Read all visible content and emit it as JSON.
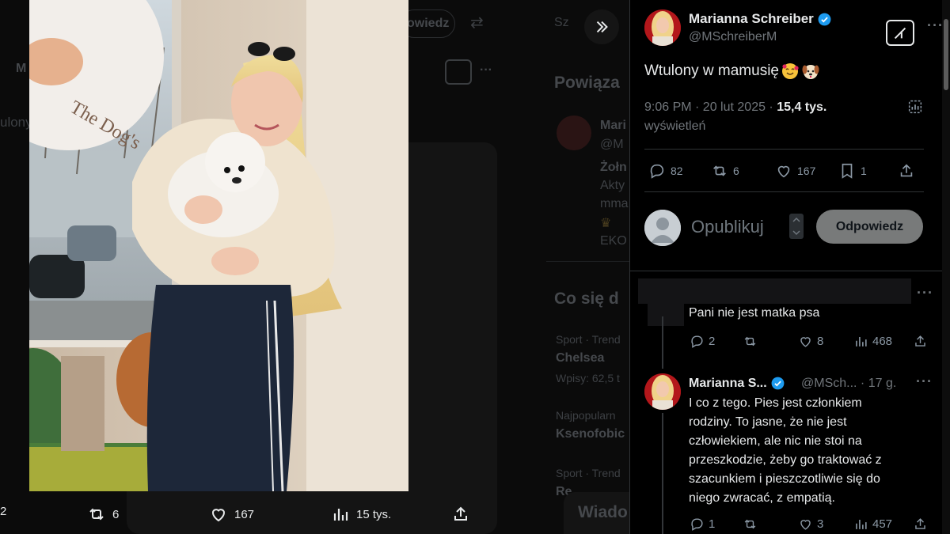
{
  "background": {
    "left_fragment_top": "M",
    "left_fragment_2": "ulony",
    "reply_button_fragment": "owiedz",
    "search_fragment": "Sz",
    "related_heading": "Powiąza",
    "related_author": "Mari",
    "related_handle": "@M",
    "related_line1": "Żołn",
    "related_line2": "Akty",
    "related_line3": "mma",
    "related_line4": "EKO",
    "trending_heading": "Co się d",
    "trend1_category": "Sport · Trend",
    "trend1_name": "Chelsea",
    "trend1_posts": "Wpisy: 62,5 t",
    "trend2_category": "Najpopularn",
    "trend2_name": "Ksenofobic",
    "trend3_category": "Sport · Trend",
    "trend3_name": "Re",
    "messages_fragment": "Wiado",
    "sign_text": "The Dog's"
  },
  "media_bar": {
    "replies_fragment": "2",
    "reposts": "6",
    "likes": "167",
    "views": "15 tys."
  },
  "post": {
    "author_name": "Marianna Schreiber",
    "author_handle": "@MSchreiberM",
    "text": "Wtulony w mamusię",
    "time": "9:06 PM · 20 lut 2025",
    "views_count": "15,4 tys.",
    "views_label": "wyświetleń",
    "replies": "82",
    "reposts": "6",
    "likes": "167",
    "bookmarks": "1"
  },
  "reply_box": {
    "placeholder": "Opublikuj",
    "button": "Odpowiedz"
  },
  "comments": [
    {
      "text": "Pani nie jest matka psa",
      "replies": "2",
      "reposts": "",
      "likes": "8",
      "views": "468"
    },
    {
      "author_name": "Marianna S...",
      "author_handle": "@MSch... · 17 g.",
      "lines": [
        "I co z tego. Pies jest członkiem",
        "rodziny. To jasne, że nie jest",
        "człowiekiem, ale nic nie stoi na",
        "przeszkodzie, żeby go traktować z",
        "szacunkiem i pieszczotliwie się do",
        "niego zwracać, z empatią."
      ],
      "replies": "1",
      "reposts": "",
      "likes": "3",
      "views": "457"
    }
  ],
  "colors": {
    "verified": "#1d9bf0",
    "muted": "#71767b",
    "text": "#e7e9ea",
    "reply_button": "#787a7a"
  }
}
